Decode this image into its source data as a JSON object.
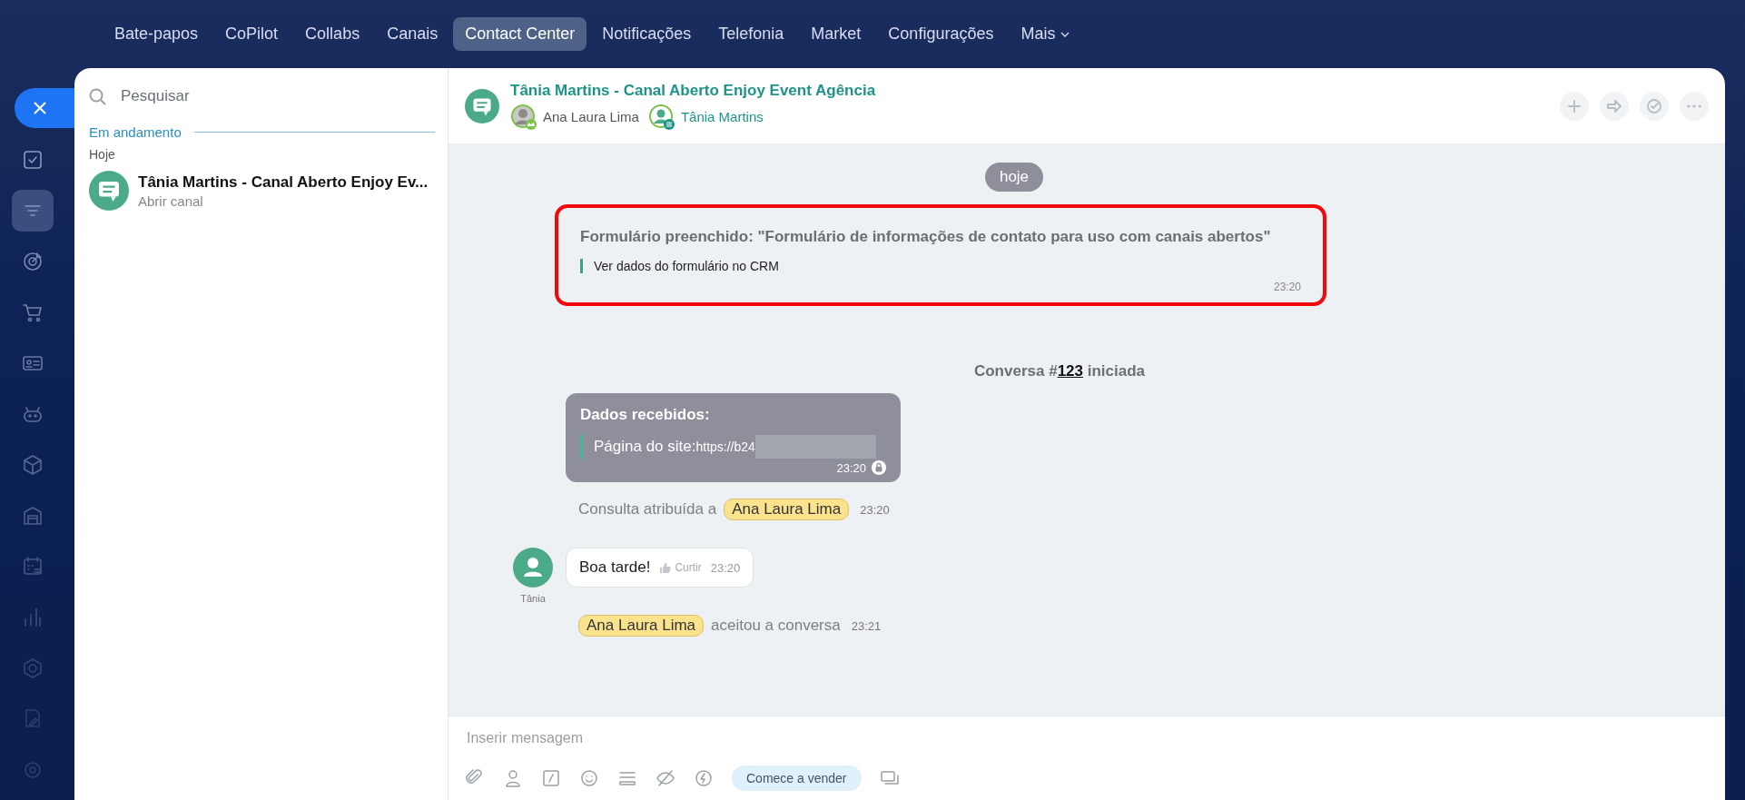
{
  "nav": [
    {
      "label": "Bate-papos",
      "selected": false,
      "dropdown": false
    },
    {
      "label": "CoPilot",
      "selected": false,
      "dropdown": false
    },
    {
      "label": "Collabs",
      "selected": false,
      "dropdown": false
    },
    {
      "label": "Canais",
      "selected": false,
      "dropdown": false
    },
    {
      "label": "Contact Center",
      "selected": true,
      "dropdown": false
    },
    {
      "label": "Notificações",
      "selected": false,
      "dropdown": false
    },
    {
      "label": "Telefonia",
      "selected": false,
      "dropdown": false
    },
    {
      "label": "Market",
      "selected": false,
      "dropdown": false
    },
    {
      "label": "Configurações",
      "selected": false,
      "dropdown": false
    },
    {
      "label": "Mais",
      "selected": false,
      "dropdown": true
    }
  ],
  "sidebar": {
    "items": [
      {
        "selected": false
      },
      {
        "selected": true
      },
      {
        "selected": false
      },
      {
        "selected": false
      },
      {
        "selected": false
      },
      {
        "selected": false
      },
      {
        "selected": false
      },
      {
        "selected": false
      },
      {
        "selected": false
      },
      {
        "selected": false
      },
      {
        "selected": false
      },
      {
        "selected": false
      },
      {
        "selected": false
      }
    ]
  },
  "chat_list": {
    "search": {
      "placeholder": "Pesquisar"
    },
    "section": "Em andamento",
    "group": "Hoje",
    "items": [
      {
        "title": "Tânia Martins - Canal Aberto Enjoy Ev...",
        "subtitle": "Abrir canal",
        "selected": false
      }
    ]
  },
  "chat": {
    "title": "Tânia Martins - Canal Aberto Enjoy Event Agência",
    "participants": [
      {
        "name": "Ana Laura Lima",
        "kind": "operator"
      },
      {
        "name": "Tânia Martins",
        "kind": "client"
      }
    ],
    "messages": [
      {
        "kind": "date",
        "text": "hoje"
      },
      {
        "kind": "form",
        "title": "Formulário preenchido: \"Formulário de informações de contato para uso com canais abertos\"",
        "link": "Ver dados do formulário no CRM",
        "time": "23:20",
        "highlighted": true
      },
      {
        "kind": "started",
        "prefix": "Conversa #",
        "number": "123",
        "suffix": "iniciada"
      },
      {
        "kind": "data",
        "title": "Dados recebidos:",
        "label": "Página do site:",
        "url": "https://b24",
        "time": "23:20"
      },
      {
        "kind": "assign",
        "text": "Consulta atribuída a",
        "user": "Ana Laura Lima",
        "time": "23:20"
      },
      {
        "kind": "message",
        "author": "Tânia",
        "text": "Boa tarde!",
        "like": "Curtir",
        "time": "23:20"
      },
      {
        "kind": "accept",
        "user": "Ana Laura Lima",
        "text": "aceitou a conversa",
        "time": "23:21"
      }
    ]
  },
  "composer": {
    "placeholder": "Inserir mensagem",
    "sell_button": "Comece a vender"
  }
}
